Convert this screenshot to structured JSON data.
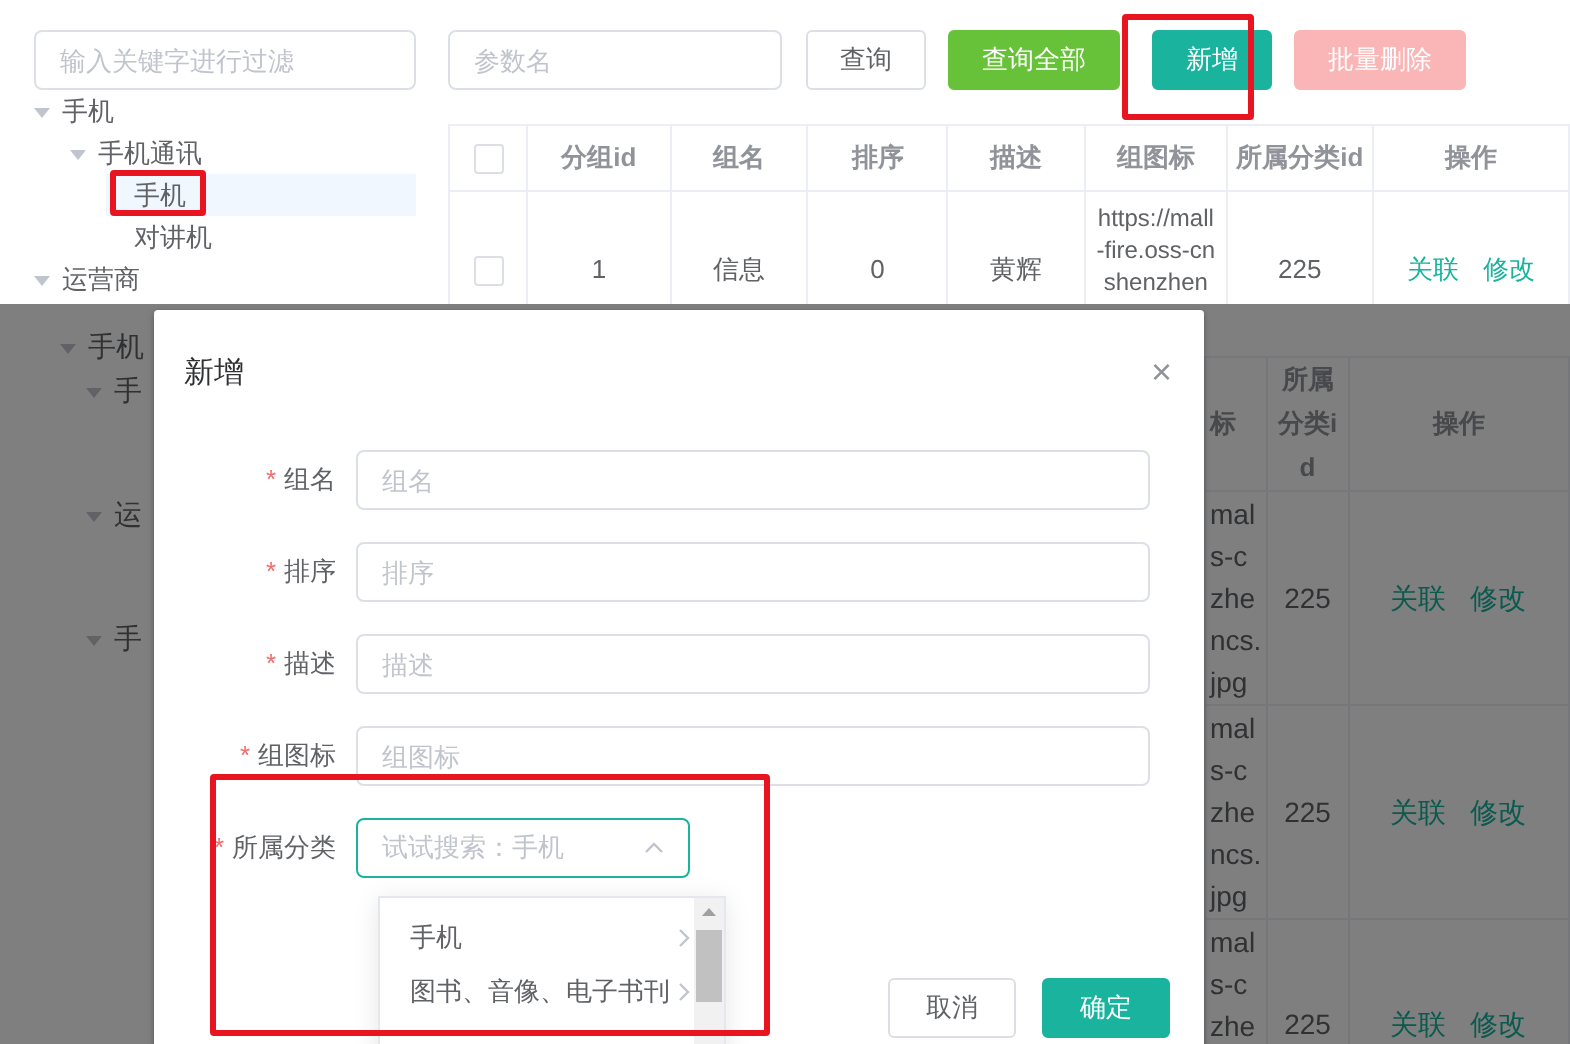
{
  "top": {
    "filter": {
      "placeholder": "输入关键字进行过滤"
    },
    "tree": [
      {
        "label": "手机",
        "expanded": true,
        "selected": false,
        "children": [
          {
            "label": "手机通讯",
            "expanded": true,
            "selected": false,
            "children": [
              {
                "label": "手机",
                "selected": true
              },
              {
                "label": "对讲机",
                "selected": false
              }
            ]
          }
        ]
      },
      {
        "label": "运营商",
        "expanded": true,
        "selected": false
      }
    ],
    "search": {
      "placeholder": "参数名"
    },
    "buttons": [
      {
        "label": "查询",
        "kind": "plain",
        "disabled": false
      },
      {
        "label": "查询全部",
        "kind": "success",
        "disabled": false
      },
      {
        "label": "新增",
        "kind": "primary",
        "disabled": false
      },
      {
        "label": "批量删除",
        "kind": "danger",
        "disabled": true
      }
    ],
    "table": {
      "header_checked": false,
      "columns": [
        "分组id",
        "组名",
        "排序",
        "描述",
        "组图标",
        "所属分类id",
        "操作"
      ],
      "rows": [
        {
          "checked": false,
          "id": "1",
          "name": "信息",
          "sort": "0",
          "desc": "黄辉",
          "icon": [
            "https://mall",
            "-fire.oss-cn",
            "shenzhen"
          ],
          "category_id": "225",
          "actions": [
            "关联",
            "修改"
          ]
        }
      ]
    }
  },
  "background": {
    "tree": [
      {
        "label": "手机",
        "expanded": true,
        "children": [
          {
            "label": "手",
            "expanded": true
          },
          {
            "label": "运",
            "expanded": true
          },
          {
            "label": "手",
            "expanded": true
          }
        ]
      }
    ],
    "table": {
      "columns": [
        "标",
        "所属分类id",
        "操作"
      ],
      "rows": [
        {
          "icon": [
            "mal",
            "s-c",
            "zhe",
            "ncs.",
            "jpg"
          ],
          "category_id": "225",
          "actions": [
            "关联",
            "修改"
          ]
        },
        {
          "icon": [
            "mal",
            "s-c",
            "zhe",
            "ncs.",
            "jpg"
          ],
          "category_id": "225",
          "actions": [
            "关联",
            "修改"
          ]
        },
        {
          "icon": [
            "mal",
            "s-c",
            "zhe"
          ],
          "category_id": "225",
          "actions": [
            "关联",
            "修改"
          ]
        }
      ]
    }
  },
  "dialog": {
    "title": "新增",
    "close": "×",
    "fields": [
      {
        "required_mark": "*",
        "label": "组名",
        "placeholder": "组名",
        "kind": "input",
        "focused": false
      },
      {
        "required_mark": "*",
        "label": "排序",
        "placeholder": "排序",
        "kind": "input",
        "focused": false
      },
      {
        "required_mark": "*",
        "label": "描述",
        "placeholder": "描述",
        "kind": "input",
        "focused": false
      },
      {
        "required_mark": "*",
        "label": "组图标",
        "placeholder": "组图标",
        "kind": "input",
        "focused": false
      },
      {
        "required_mark": "*",
        "label": "所属分类",
        "placeholder": "试试搜索：手机",
        "kind": "select",
        "focused": true
      }
    ],
    "options": [
      {
        "label": "手机"
      },
      {
        "label": "图书、音像、电子书刊"
      }
    ],
    "buttons": [
      {
        "label": "取消",
        "kind": "plain"
      },
      {
        "label": "确定",
        "kind": "primary"
      }
    ]
  }
}
